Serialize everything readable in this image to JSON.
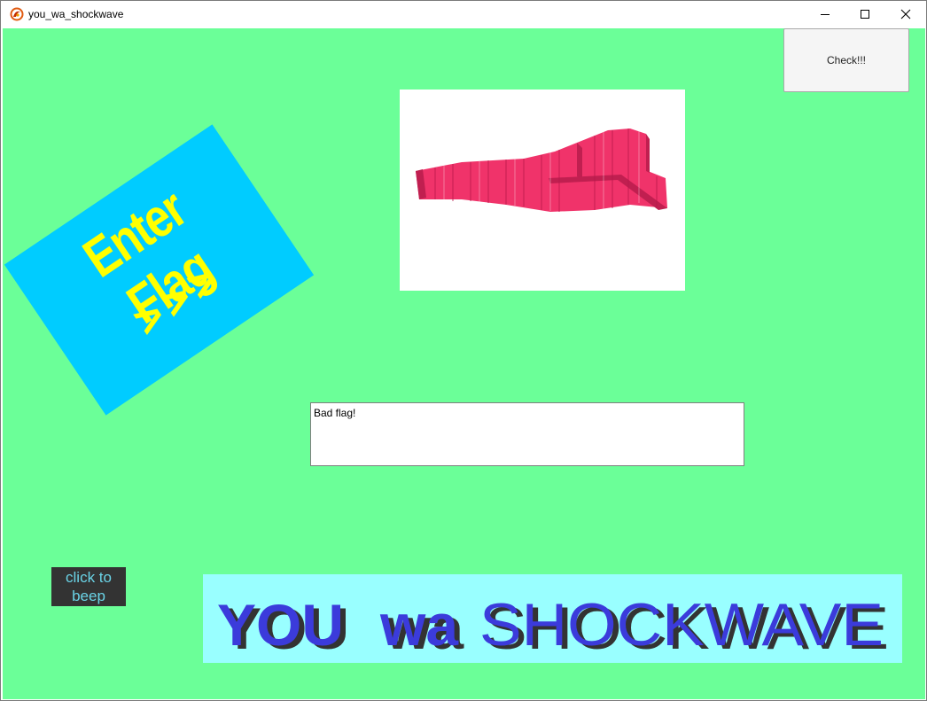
{
  "window": {
    "title": "you_wa_shockwave"
  },
  "controls": {
    "check_label": "Check!!!",
    "beep_line1": "click to",
    "beep_line2": "beep"
  },
  "sign": {
    "title": "Enter Flag",
    "arrows": ">>>"
  },
  "output": {
    "value": "Bad flag!"
  },
  "banner": {
    "text_part1": "YOU",
    "text_part2": "wa",
    "text_part3": "SHOCKWAVE"
  },
  "colors": {
    "background": "#6bff98",
    "sign_panel": "#00ccff",
    "sign_text": "#ffff00",
    "banner_bg": "#99ffff",
    "banner_text": "#3b3bdb",
    "model_pink": "#f0336a"
  }
}
